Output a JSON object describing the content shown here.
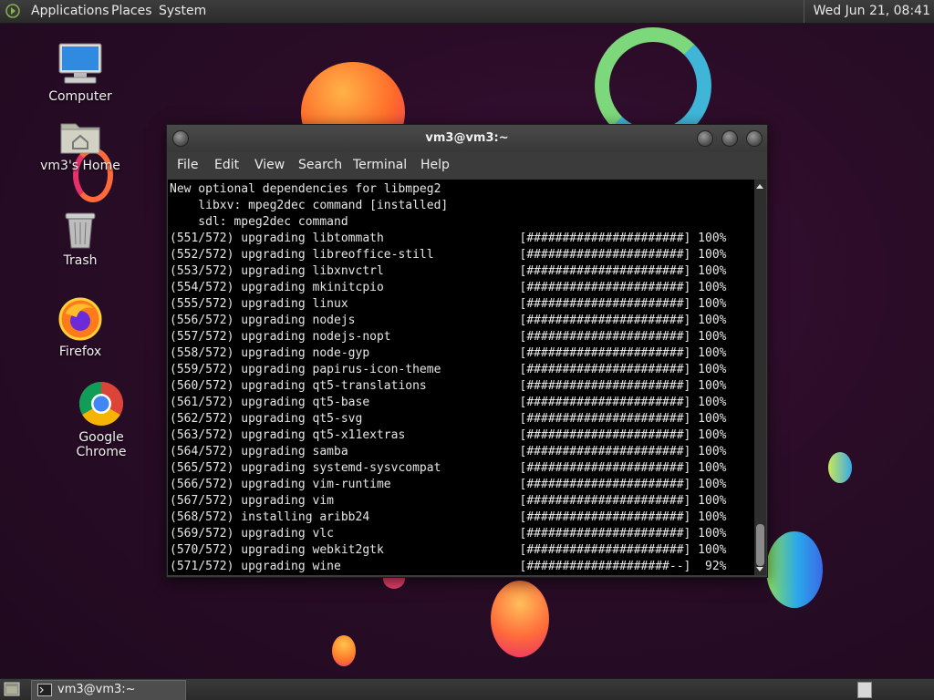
{
  "top_panel": {
    "menus": [
      "Applications",
      "Places",
      "System"
    ],
    "clock": "Wed Jun 21, 08:41"
  },
  "desktop_icons": {
    "computer": "Computer",
    "home": "vm3's Home",
    "trash": "Trash",
    "firefox": "Firefox",
    "chrome": "Google Chrome"
  },
  "terminal": {
    "title": "vm3@vm3:~",
    "menu": [
      "File",
      "Edit",
      "View",
      "Search",
      "Terminal",
      "Help"
    ],
    "lines": [
      "New optional dependencies for libmpeg2",
      "    libxv: mpeg2dec command [installed]",
      "    sdl: mpeg2dec command",
      "(551/572) upgrading libtommath                   [######################] 100%",
      "(552/572) upgrading libreoffice-still            [######################] 100%",
      "(553/572) upgrading libxnvctrl                   [######################] 100%",
      "(554/572) upgrading mkinitcpio                   [######################] 100%",
      "(555/572) upgrading linux                        [######################] 100%",
      "(556/572) upgrading nodejs                       [######################] 100%",
      "(557/572) upgrading nodejs-nopt                  [######################] 100%",
      "(558/572) upgrading node-gyp                     [######################] 100%",
      "(559/572) upgrading papirus-icon-theme           [######################] 100%",
      "(560/572) upgrading qt5-translations             [######################] 100%",
      "(561/572) upgrading qt5-base                     [######################] 100%",
      "(562/572) upgrading qt5-svg                      [######################] 100%",
      "(563/572) upgrading qt5-x11extras                [######################] 100%",
      "(564/572) upgrading samba                        [######################] 100%",
      "(565/572) upgrading systemd-sysvcompat           [######################] 100%",
      "(566/572) upgrading vim-runtime                  [######################] 100%",
      "(567/572) upgrading vim                          [######################] 100%",
      "(568/572) installing aribb24                     [######################] 100%",
      "(569/572) upgrading vlc                          [######################] 100%",
      "(570/572) upgrading webkit2gtk                   [######################] 100%",
      "(571/572) upgrading wine                         [####################--]  92%"
    ]
  },
  "taskbar": {
    "window_button": "vm3@vm3:~"
  }
}
